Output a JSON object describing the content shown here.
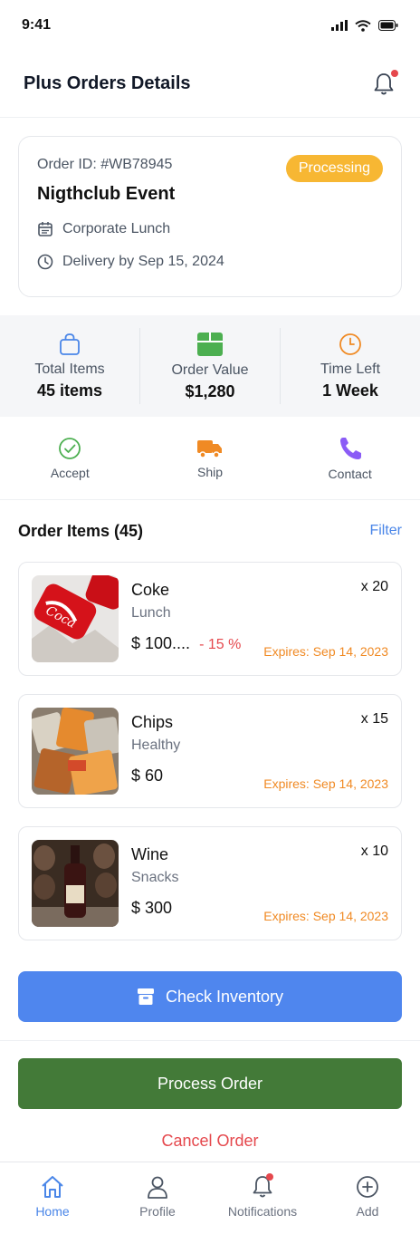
{
  "status_bar": {
    "time": "9:41"
  },
  "header": {
    "title": "Plus Orders Details"
  },
  "order": {
    "id_label": "Order ID: #WB78945",
    "name": "Nigthclub Event",
    "status": "Processing",
    "category": "Corporate Lunch",
    "delivery": "Delivery by Sep 15, 2024",
    "colors": {
      "status": "#f7b733"
    }
  },
  "stats": [
    {
      "label": "Total Items",
      "value": "45 items",
      "icon": "bag-icon",
      "color": "#4a86e8"
    },
    {
      "label": "Order Value",
      "value": "$1,280",
      "icon": "box-icon",
      "color": "#4caf50"
    },
    {
      "label": "Time Left",
      "value": "1 Week",
      "icon": "clock-icon",
      "color": "#f08a24"
    }
  ],
  "actions": [
    {
      "label": "Accept",
      "icon": "check-circle-icon",
      "color": "#4caf50"
    },
    {
      "label": "Ship",
      "icon": "truck-icon",
      "color": "#f08a24"
    },
    {
      "label": "Contact",
      "icon": "phone-icon",
      "color": "#8b5cf6"
    }
  ],
  "items_section": {
    "title": "Order Items (45)",
    "filter": "Filter"
  },
  "items": [
    {
      "name": "Coke",
      "category": "Lunch",
      "price": "$ 100....",
      "discount": "- 15 %",
      "qty": "x 20",
      "expiry": "Expires: Sep 14, 2023",
      "image": "coke-can-image"
    },
    {
      "name": "Chips",
      "category": "Healthy",
      "price": "$ 60",
      "discount": "",
      "qty": "x 15",
      "expiry": "Expires: Sep 14, 2023",
      "image": "chips-bags-image"
    },
    {
      "name": "Wine",
      "category": "Snacks",
      "price": "$ 300",
      "discount": "",
      "qty": "x 10",
      "expiry": "Expires: Sep 14, 2023",
      "image": "wine-bottle-image"
    }
  ],
  "buttons": {
    "check_inventory": "Check Inventory",
    "process_order": "Process Order",
    "cancel_order": "Cancel Order"
  },
  "nav": [
    {
      "label": "Home",
      "icon": "home-icon",
      "active": true
    },
    {
      "label": "Profile",
      "icon": "person-icon",
      "active": false
    },
    {
      "label": "Notifications",
      "icon": "bell-icon",
      "active": false
    },
    {
      "label": "Add",
      "icon": "plus-circle-icon",
      "active": false
    }
  ],
  "colors": {
    "primary_blue": "#4f86ee",
    "process_green": "#437a38",
    "danger_red": "#e5484d",
    "expiry_orange": "#f08a24"
  }
}
